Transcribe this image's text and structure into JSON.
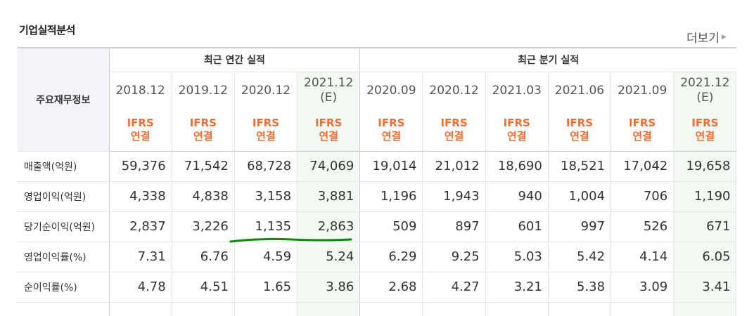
{
  "section": {
    "title": "기업실적분석",
    "more_link": "더보기"
  },
  "table": {
    "corner_label": "주요재무정보",
    "groups": {
      "annual": "최근 연간 실적",
      "quarterly": "최근 분기 실적"
    },
    "periods": [
      {
        "line1": "2018.12",
        "line2": ""
      },
      {
        "line1": "2019.12",
        "line2": ""
      },
      {
        "line1": "2020.12",
        "line2": ""
      },
      {
        "line1": "2021.12",
        "line2": "(E)"
      },
      {
        "line1": "2020.09",
        "line2": ""
      },
      {
        "line1": "2020.12",
        "line2": ""
      },
      {
        "line1": "2021.03",
        "line2": ""
      },
      {
        "line1": "2021.06",
        "line2": ""
      },
      {
        "line1": "2021.09",
        "line2": ""
      },
      {
        "line1": "2021.12",
        "line2": "(E)"
      }
    ],
    "basis": {
      "line1": "IFRS",
      "line2": "연결"
    },
    "rows": [
      {
        "label": "매출액(억원)",
        "values": [
          "59,376",
          "71,542",
          "68,728",
          "74,069",
          "19,014",
          "21,012",
          "18,690",
          "18,521",
          "17,042",
          "19,658"
        ]
      },
      {
        "label": "영업이익(억원)",
        "values": [
          "4,338",
          "4,838",
          "3,158",
          "3,881",
          "1,196",
          "1,943",
          "940",
          "1,004",
          "706",
          "1,190"
        ]
      },
      {
        "label": "당기순이익(억원)",
        "values": [
          "2,837",
          "3,226",
          "1,135",
          "2,863",
          "509",
          "897",
          "601",
          "997",
          "526",
          "671"
        ]
      },
      {
        "label": "영업이익률(%)",
        "values": [
          "7.31",
          "6.76",
          "4.59",
          "5.24",
          "6.29",
          "9.25",
          "5.03",
          "5.42",
          "4.14",
          "6.05"
        ]
      },
      {
        "label": "순이익률(%)",
        "values": [
          "4.78",
          "4.51",
          "1.65",
          "3.86",
          "2.68",
          "4.27",
          "3.21",
          "5.38",
          "3.09",
          "3.41"
        ]
      }
    ]
  },
  "colors": {
    "ifrs_text": "#ee6e36",
    "estimate_bg": "#f2f8f2",
    "header_bg": "#f2f4f7",
    "annotation_stroke": "#0b8a0b"
  }
}
